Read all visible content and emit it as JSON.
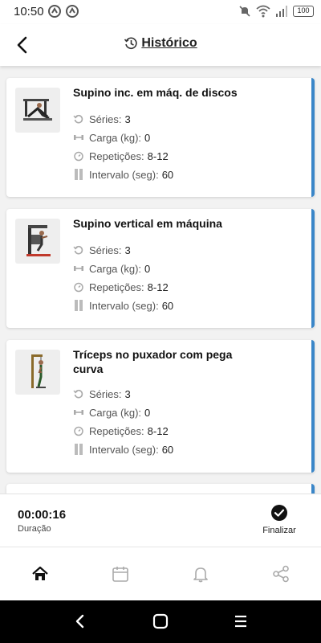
{
  "status_bar": {
    "time": "10:50",
    "battery": "100"
  },
  "header": {
    "title": "Histórico"
  },
  "exercises": [
    {
      "name": "Supino inc. em máq. de discos",
      "stats": [
        {
          "label": "Séries:",
          "value": "3"
        },
        {
          "label": "Carga (kg):",
          "value": "0"
        },
        {
          "label": "Repetições:",
          "value": "8-12"
        },
        {
          "label": "Intervalo (seg):",
          "value": "60"
        }
      ]
    },
    {
      "name": "Supino vertical em máquina",
      "stats": [
        {
          "label": "Séries:",
          "value": "3"
        },
        {
          "label": "Carga (kg):",
          "value": "0"
        },
        {
          "label": "Repetições:",
          "value": "8-12"
        },
        {
          "label": "Intervalo (seg):",
          "value": "60"
        }
      ]
    },
    {
      "name": "Tríceps no puxador com pega curva",
      "stats": [
        {
          "label": "Séries:",
          "value": "3"
        },
        {
          "label": "Carga (kg):",
          "value": "0"
        },
        {
          "label": "Repetições:",
          "value": "8-12"
        },
        {
          "label": "Intervalo (seg):",
          "value": "60"
        }
      ]
    }
  ],
  "timer": {
    "value": "00:00:16",
    "label": "Duração"
  },
  "finalize": {
    "label": "Finalizar"
  },
  "nav": [
    {
      "icon": "home-icon"
    },
    {
      "icon": "calendar-icon"
    },
    {
      "icon": "bell-icon"
    },
    {
      "icon": "share-icon"
    }
  ],
  "colors": {
    "accent": "#3a86c8",
    "background": "#f2f2f2"
  }
}
